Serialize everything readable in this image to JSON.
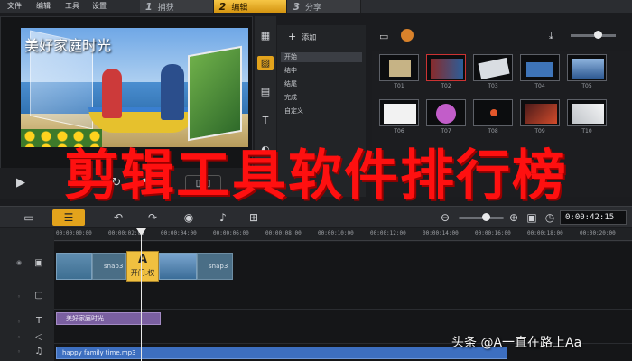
{
  "menu": {
    "file": "文件",
    "edit": "编辑",
    "tools": "工具",
    "settings": "设置"
  },
  "steps": [
    {
      "num": "1",
      "label": "捕获"
    },
    {
      "num": "2",
      "label": "编辑"
    },
    {
      "num": "3",
      "label": "分享"
    }
  ],
  "preview": {
    "title": "美好家庭时光"
  },
  "library": {
    "add_label": "添加",
    "categories": [
      "开始",
      "结中",
      "结尾",
      "完成",
      "自定义"
    ],
    "thumb_labels": [
      "T01",
      "T02",
      "T03",
      "T04",
      "T05",
      "T06",
      "T07",
      "T08",
      "T09",
      "T10"
    ]
  },
  "headline": "剪辑工具软件排行榜",
  "timeline": {
    "timecode": "0:00:42:15",
    "ticks": [
      "00:00:00:00",
      "00:00:02:00",
      "00:00:04:00",
      "00:00:06:00",
      "00:00:08:00",
      "00:00:10:00",
      "00:00:12:00",
      "00:00:14:00",
      "00:00:16:00",
      "00:00:18:00",
      "00:00:20:00"
    ],
    "clip_snap_1": "snap3",
    "clip_snap_2": "snap3",
    "transition_label": "开门.权",
    "title_clip": "美好家庭时光",
    "music_clip": "happy family time.mp3",
    "zoom_level": 0.6
  },
  "watermark": "头条 @A一直在路上Aa"
}
